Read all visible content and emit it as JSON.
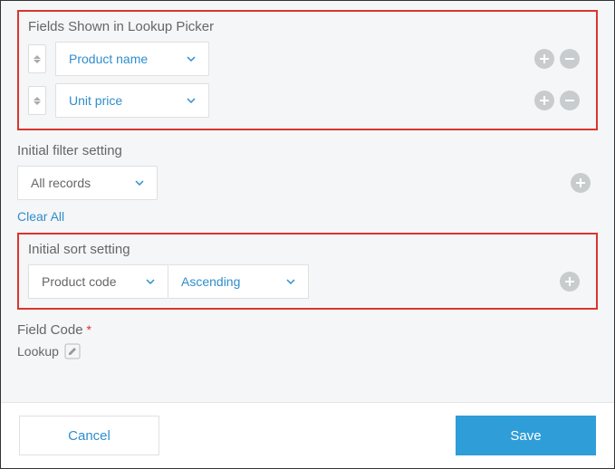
{
  "lookup_picker": {
    "title": "Fields Shown in Lookup Picker",
    "rows": [
      {
        "label": "Product name"
      },
      {
        "label": "Unit price"
      }
    ]
  },
  "filter": {
    "title": "Initial filter setting",
    "value": "All records",
    "clear_label": "Clear All"
  },
  "sort": {
    "title": "Initial sort setting",
    "field": "Product code",
    "direction": "Ascending"
  },
  "field_code": {
    "label": "Field Code",
    "required_mark": "*",
    "value": "Lookup"
  },
  "footer": {
    "cancel": "Cancel",
    "save": "Save"
  }
}
